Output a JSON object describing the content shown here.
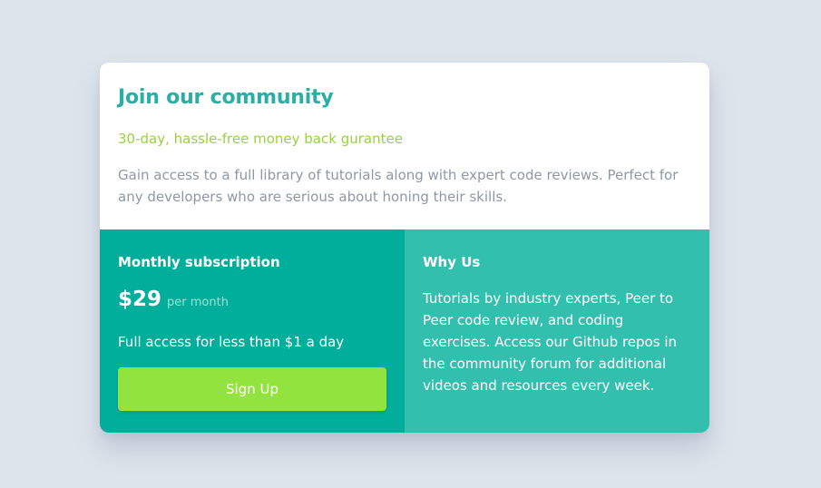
{
  "header": {
    "title": "Join our community",
    "subtitle": "30-day, hassle-free money back gurantee",
    "description": "Gain access to a full library of tutorials along with expert code reviews. Perfect for any developers who are serious about honing their skills."
  },
  "subscription": {
    "heading": "Monthly subscription",
    "price": "$29",
    "period": "per month",
    "tagline": "Full access for less than $1 a day",
    "button_label": "Sign Up"
  },
  "why_us": {
    "heading": "Why Us",
    "body": "Tutorials by industry experts, Peer to Peer code review, and coding exercises. Access our Github repos in the community forum for additional videos and resources every week."
  },
  "colors": {
    "background": "#dde4ec",
    "title": "#2baea3",
    "subtitle": "#99d23e",
    "left_panel": "#01ae9b",
    "right_panel": "#32bfae",
    "button": "#93e33f"
  }
}
